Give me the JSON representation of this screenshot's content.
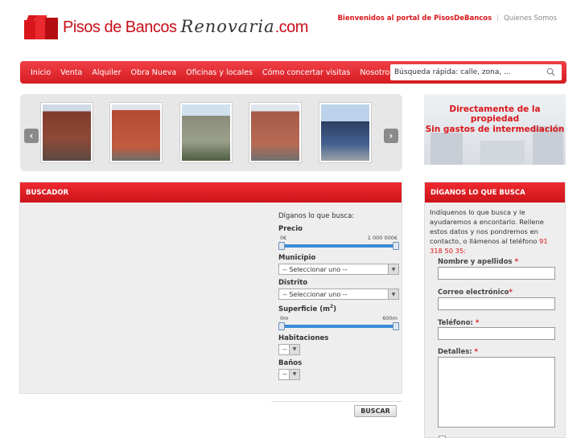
{
  "header": {
    "logo_main": "Pisos de Bancos ",
    "logo_script": "Renovaria",
    "logo_suffix": ".com",
    "welcome": "Bienvenidos al portal de PisosDeBancos",
    "separator": "|",
    "quienes": "Quienes Somos"
  },
  "nav": {
    "items": [
      "Inicio",
      "Venta",
      "Alquiler",
      "Obra Nueva",
      "Oficinas y locales",
      "Cómo concertar visitas",
      "Nosotros"
    ],
    "search_placeholder": "Búsqueda rápida: calle, zona, ..."
  },
  "slider": {
    "prev": "‹",
    "next": "›"
  },
  "banner": {
    "line1": "Directamente de la propiedad",
    "line2": "Sin gastos de intermediación"
  },
  "buscador": {
    "title": "BUSCADOR",
    "intro": "Díganos lo que busca:",
    "precio_label": "Precio",
    "precio_min": "0€",
    "precio_max": "1 000 000€",
    "precio_range": [
      0,
      1000000
    ],
    "municipio_label": "Municipio",
    "municipio_value": "-- Seleccionar uno --",
    "distrito_label": "Distrito",
    "distrito_value": "-- Seleccionar uno --",
    "superficie_label": "Superficie (m",
    "superficie_sup": "2",
    "superficie_close": ")",
    "superficie_min": "0m",
    "superficie_max": "600m",
    "superficie_range": [
      0,
      600
    ],
    "habitaciones_label": "Habitaciones",
    "habitaciones_value": "--",
    "banos_label": "Baños",
    "banos_value": "--",
    "button": "BUSCAR"
  },
  "contact": {
    "title": "DÍGANOS LO QUE BUSCA",
    "intro": "Indíquenos lo que busca y le ayudaremos a encontarlo. Rellene estos datos y nos pondremos en contacto, o llámenos al teléfono ",
    "phone": "91 318 50 35:",
    "nombre_label": "Nombre y apellidos",
    "correo_label": "Correo electrónico",
    "telefono_label": "Teléfono:",
    "detalles_label": "Detalles:",
    "required_mark": "*"
  }
}
